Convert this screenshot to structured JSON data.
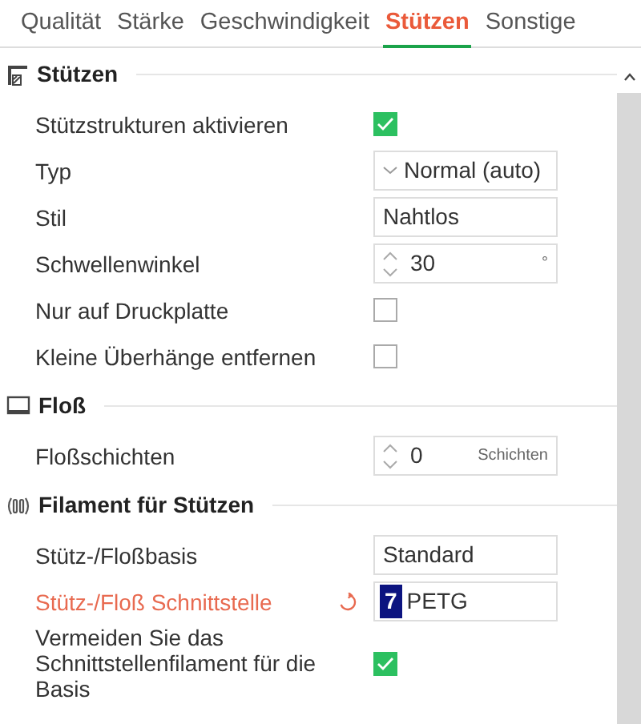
{
  "tabs": [
    {
      "label": "Qualität",
      "selected": false
    },
    {
      "label": "Stärke",
      "selected": false
    },
    {
      "label": "Geschwindigkeit",
      "selected": false
    },
    {
      "label": "Stützen",
      "selected": true
    },
    {
      "label": "Sonstige",
      "selected": false
    }
  ],
  "sections": [
    {
      "title": "Stützen",
      "kind": "support",
      "rows": [
        {
          "kind": "checkbox",
          "label": "Stützstrukturen aktivieren",
          "checked": true,
          "modified": false
        },
        {
          "kind": "select",
          "label": "Typ",
          "value": "Normal (auto)",
          "modified": false
        },
        {
          "kind": "text",
          "label": "Stil",
          "value": "Nahtlos",
          "modified": false
        },
        {
          "kind": "spin",
          "label": "Schwellenwinkel",
          "value": "30",
          "unit": "°",
          "modified": false
        },
        {
          "kind": "checkbox",
          "label": "Nur auf Druckplatte",
          "checked": false,
          "modified": false
        },
        {
          "kind": "checkbox",
          "label": "Kleine Überhänge entfernen",
          "checked": false,
          "modified": false
        }
      ]
    },
    {
      "title": "Floß",
      "kind": "raft",
      "rows": [
        {
          "kind": "spin",
          "label": "Floßschichten",
          "value": "0",
          "unit": "Schichten",
          "modified": false
        }
      ]
    },
    {
      "title": "Filament für Stützen",
      "kind": "filament",
      "rows": [
        {
          "kind": "text",
          "label": "Stütz-/Floßbasis",
          "value": "Standard",
          "modified": false
        },
        {
          "kind": "filament",
          "label": "Stütz-/Floß Schnittstelle",
          "number": "7",
          "color": "#0c1480",
          "value": "PETG",
          "modified": true
        },
        {
          "kind": "checkbox",
          "label": "Vermeiden Sie das Schnittstellenfilament für die Basis",
          "checked": true,
          "modified": false
        }
      ]
    }
  ]
}
